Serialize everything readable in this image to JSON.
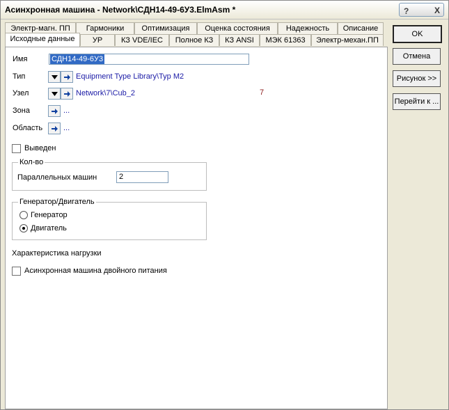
{
  "window": {
    "title": "Асинхронная машина - Network\\СДН14-49-6У3.ElmAsm *"
  },
  "title_buttons": {
    "help": "?",
    "close": "X"
  },
  "tabs_row1": [
    "Электр-магн. ПП",
    "Гармоники",
    "Оптимизация",
    "Оценка состояния",
    "Надежность",
    "Описание"
  ],
  "tabs_row2": [
    "Исходные данные",
    "УР",
    "КЗ VDE/IEC",
    "Полное КЗ",
    "КЗ ANSI",
    "МЭК 61363",
    "Электр-механ.ПП"
  ],
  "form": {
    "name_label": "Имя",
    "name_value": "СДН14-49-6У3",
    "type_label": "Тип",
    "type_value": "Equipment Type Library\\Typ M2",
    "node_label": "Узел",
    "node_value": "Network\\7\\Cub_2",
    "node_number": "7",
    "zone_label": "Зона",
    "zone_value": "...",
    "area_label": "Область",
    "area_value": "...",
    "out_of_service_label": "Выведен",
    "count_group": "Кол-во",
    "parallel_label": "Параллельных машин",
    "parallel_value": "2",
    "gen_motor_group": "Генератор/Двигатель",
    "generator_label": "Генератор",
    "motor_label": "Двигатель",
    "load_char_label": "Характеристика нагрузки",
    "double_fed_label": "Асинхронная машина двойного питания"
  },
  "side_buttons": {
    "ok": "OK",
    "cancel": "Отмена",
    "figure": "Рисунок >>",
    "goto": "Перейти к ..."
  },
  "colors": {
    "link": "#1a1aa6",
    "selection": "#316ac5",
    "node_number": "#8b1a1a"
  },
  "icons": [
    "chevron-down-icon",
    "arrow-right-icon"
  ]
}
